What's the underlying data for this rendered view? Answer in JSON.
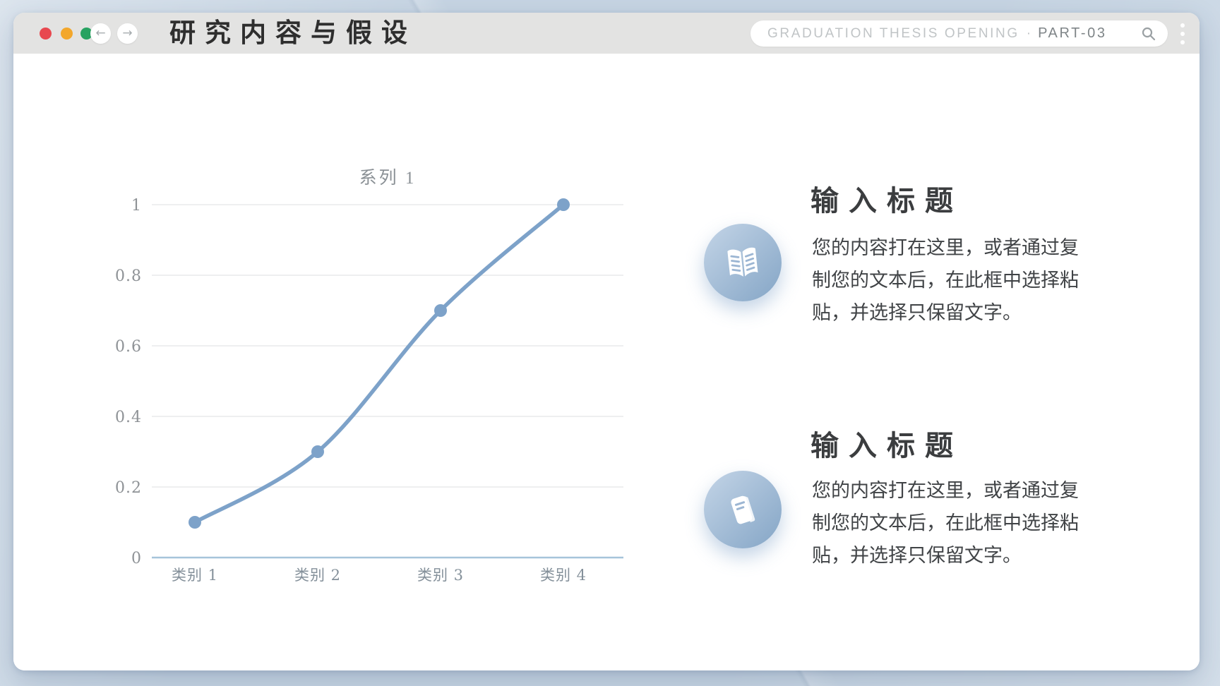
{
  "window": {
    "title": "研究内容与假设",
    "traffic_lights": [
      {
        "name": "close",
        "color": "#e8484f"
      },
      {
        "name": "minimize",
        "color": "#f3a72b"
      },
      {
        "name": "maximize",
        "color": "#27a261"
      }
    ],
    "nav": {
      "back": "←",
      "forward": "→"
    },
    "address_bar": {
      "label": "GRADUATION THESIS OPENING",
      "separator": "·",
      "part": "PART-03",
      "search_icon": "magnifier-icon"
    },
    "menu_icon": "kebab-vertical-icon"
  },
  "chart_data": {
    "type": "line",
    "title": "系列 1",
    "categories": [
      "类别 1",
      "类别 2",
      "类别 3",
      "类别 4"
    ],
    "series": [
      {
        "name": "系列 1",
        "values": [
          0.1,
          0.3,
          0.7,
          1.0
        ]
      }
    ],
    "xlabel": "",
    "ylabel": "",
    "ylim": [
      0,
      1
    ],
    "yticks": [
      "0",
      "0.2",
      "0.4",
      "0.6",
      "0.8",
      "1"
    ],
    "grid": true,
    "legend_position": "none",
    "smooth": true,
    "line_color": "#7da2c9",
    "axis_color": "#a6c4da"
  },
  "sections": [
    {
      "icon": "open-book-icon",
      "title": "输 入 标 题",
      "body_lines": [
        "您的内容打在这里，或者通过复",
        "制您的文本后，在此框中选择粘",
        "贴，并选择只保留文字。"
      ]
    },
    {
      "icon": "notebook-icon",
      "title": "输 入 标 题",
      "body_lines": [
        "您的内容打在这里，或者通过复",
        "制您的文本后，在此框中选择粘",
        "贴，并选择只保留文字。"
      ]
    }
  ],
  "colors": {
    "background": "#c7d5e3",
    "toolbar": "#e3e3e2",
    "accent_blue": "#7da2c9",
    "icon_circle_from": "#bccfe3",
    "icon_circle_to": "#8cabca",
    "heading_text": "#3b3d3f",
    "body_text": "#404346"
  }
}
